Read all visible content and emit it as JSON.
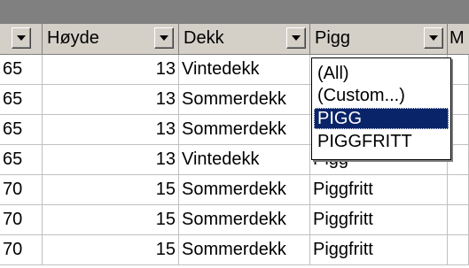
{
  "columns": {
    "hoyde": "Høyde",
    "dekk": "Dekk",
    "pigg": "Pigg",
    "next": "M"
  },
  "rows": [
    {
      "a": "65",
      "hoyde": "13",
      "dekk": "Vintedekk",
      "pigg": ""
    },
    {
      "a": "65",
      "hoyde": "13",
      "dekk": "Sommerdekk",
      "pigg": ""
    },
    {
      "a": "65",
      "hoyde": "13",
      "dekk": "Sommerdekk",
      "pigg": ""
    },
    {
      "a": "65",
      "hoyde": "13",
      "dekk": "Vintedekk",
      "pigg": "Pigg"
    },
    {
      "a": "70",
      "hoyde": "15",
      "dekk": "Sommerdekk",
      "pigg": "Piggfritt"
    },
    {
      "a": "70",
      "hoyde": "15",
      "dekk": "Sommerdekk",
      "pigg": "Piggfritt"
    },
    {
      "a": "70",
      "hoyde": "15",
      "dekk": "Sommerdekk",
      "pigg": "Piggfritt"
    }
  ],
  "filter_dropdown": {
    "options": [
      "(All)",
      "(Custom...)",
      "PIGG",
      "PIGGFRITT"
    ],
    "selected": "PIGG"
  },
  "icons": {
    "header_dropdown": "dropdown-arrow-icon"
  },
  "colors": {
    "header_bg": "#d4d0c8",
    "selection": "#0a246a"
  }
}
